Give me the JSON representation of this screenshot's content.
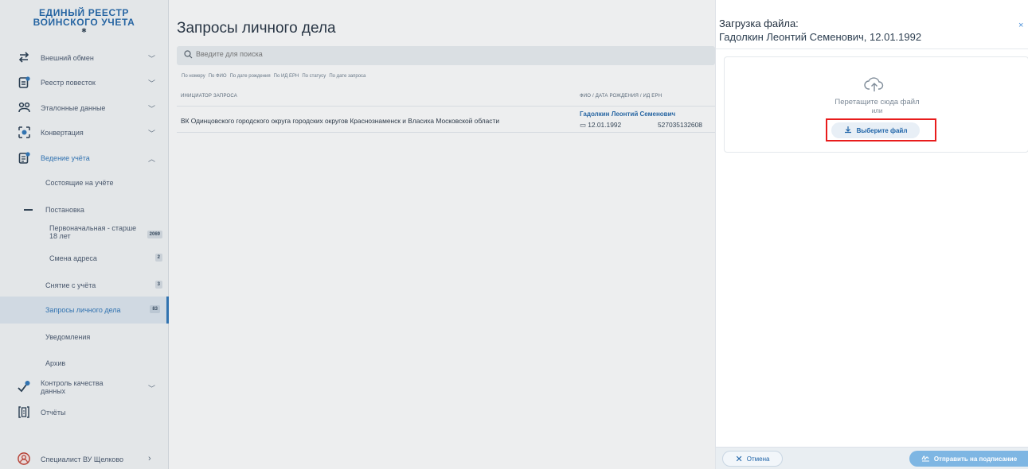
{
  "brand": {
    "line1": "ЕДИНЫЙ РЕЕСТР",
    "line2": "ВОИНСКОГО УЧЕТА"
  },
  "sidebar": {
    "items": [
      {
        "label": "Внешний обмен",
        "icon": "exchange-icon"
      },
      {
        "label": "Реестр повесток",
        "icon": "summons-icon"
      },
      {
        "label": "Эталонные данные",
        "icon": "reference-data-icon"
      },
      {
        "label": "Конвертация",
        "icon": "conversion-icon"
      },
      {
        "label": "Ведение учёта",
        "icon": "records-icon"
      }
    ],
    "sub": {
      "registered": "Состоящие на учёте",
      "enrollment": "Постановка",
      "initial": "Первоначальная - старше 18 лет",
      "initial_badge": "2069",
      "address": "Смена адреса",
      "address_badge": "2",
      "removal": "Снятие с учёта",
      "removal_badge": "3",
      "requests": "Запросы личного дела",
      "requests_badge": "83",
      "notifications": "Уведомления",
      "archive": "Архив"
    },
    "quality": "Контроль качества данных",
    "reports": "Отчёты",
    "user": "Специалист ВУ Щелково"
  },
  "main": {
    "title": "Запросы личного дела",
    "search_placeholder": "Введите для поиска",
    "filters": [
      "По номеру",
      "По ФИО",
      "По дате рождения",
      "По ИД ЕРН",
      "По статусу",
      "По дате запроса"
    ],
    "col_initiator": "ИНИЦИАТОР ЗАПРОСА",
    "col_fio": "ФИО / ДАТА РОЖДЕНИЯ / ИД ЕРН",
    "row": {
      "initiator": "ВК Одинцовского городского округа городских округов Краснознаменск и Власиха Московской области",
      "fio": "Гадолкин Леонтий Семенович",
      "dob": "12.01.1992",
      "ern": "527035132608"
    }
  },
  "drawer": {
    "title": "Загрузка файла:",
    "subtitle": "Гадолкин Леонтий Семенович, 12.01.1992",
    "close": "×",
    "drop_text": "Перетащите сюда файл",
    "or": "или",
    "pick_label": "Выберите файл",
    "cancel_label": "Отмена",
    "sign_label": "Отправить на подписание"
  },
  "colors": {
    "accent": "#1d63a8",
    "highlight": "#e81c1c",
    "primary_button": "#7eb6e3"
  }
}
